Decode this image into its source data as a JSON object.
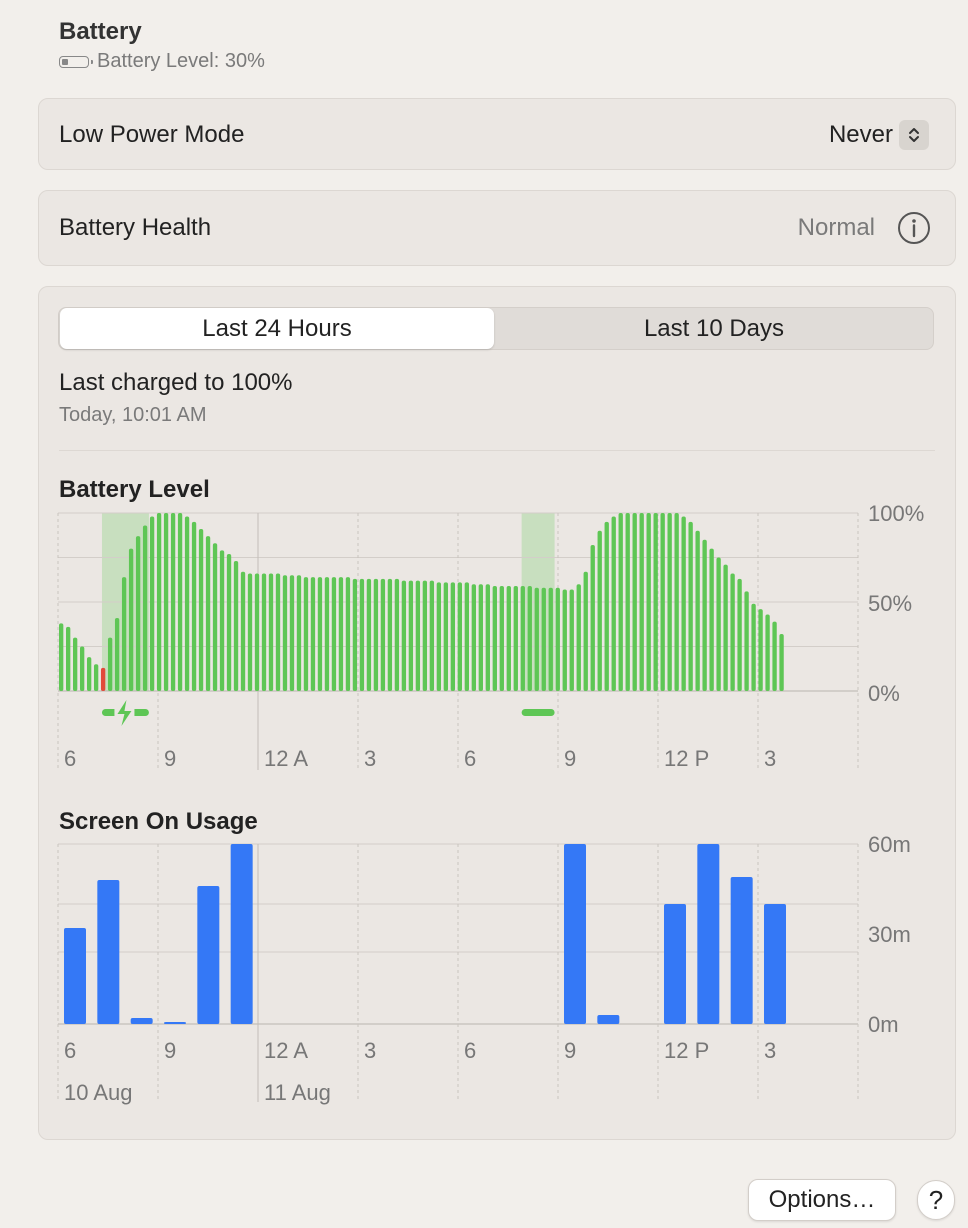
{
  "header": {
    "title": "Battery",
    "battery_level": "Battery Level: 30%"
  },
  "low_power_mode": {
    "label": "Low Power Mode",
    "value": "Never"
  },
  "battery_health": {
    "label": "Battery Health",
    "value": "Normal"
  },
  "tabs": [
    {
      "label": "Last 24 Hours",
      "selected": true
    },
    {
      "label": "Last 10 Days",
      "selected": false
    }
  ],
  "last_charged": {
    "title": "Last charged to 100%",
    "time": "Today, 10:01 AM"
  },
  "buttons": {
    "options": "Options…",
    "help": "?"
  },
  "colors": {
    "battery_bar": "#5ec655",
    "low_battery_bar": "#e24a3a",
    "charging_band": "#5ec655",
    "usage_bar": "#3478f6"
  },
  "chart_data": [
    {
      "type": "bar",
      "title": "Battery Level",
      "x_tick_labels": [
        "6",
        "9",
        "12 A",
        "3",
        "6",
        "9",
        "12 P",
        "3"
      ],
      "y_tick_labels": [
        "100%",
        "50%",
        "0%"
      ],
      "ylim": [
        0,
        100
      ],
      "unit": "%",
      "interval_minutes": 15,
      "values": [
        38,
        36,
        30,
        25,
        19,
        15,
        13,
        30,
        41,
        64,
        80,
        87,
        93,
        98,
        100,
        100,
        100,
        100,
        98,
        95,
        91,
        87,
        83,
        79,
        77,
        73,
        67,
        66,
        66,
        66,
        66,
        66,
        65,
        65,
        65,
        64,
        64,
        64,
        64,
        64,
        64,
        64,
        63,
        63,
        63,
        63,
        63,
        63,
        63,
        62,
        62,
        62,
        62,
        62,
        61,
        61,
        61,
        61,
        61,
        60,
        60,
        60,
        59,
        59,
        59,
        59,
        59,
        59,
        58,
        58,
        58,
        58,
        57,
        57,
        60,
        67,
        82,
        90,
        95,
        98,
        100,
        100,
        100,
        100,
        100,
        100,
        100,
        100,
        100,
        98,
        95,
        90,
        85,
        80,
        75,
        71,
        66,
        63,
        56,
        49,
        46,
        43,
        39,
        32
      ],
      "low_indices": [
        6
      ],
      "charging_periods": [
        {
          "start_index": 6,
          "end_index": 12
        },
        {
          "start_index": 66,
          "end_index": 70
        }
      ]
    },
    {
      "type": "bar",
      "title": "Screen On Usage",
      "x_tick_labels": [
        "6",
        "9",
        "12 A",
        "3",
        "6",
        "9",
        "12 P",
        "3"
      ],
      "date_labels": [
        "10 Aug",
        "11 Aug"
      ],
      "y_tick_labels": [
        "60m",
        "30m",
        "0m"
      ],
      "ylim": [
        0,
        60
      ],
      "unit": "minutes",
      "interval_minutes": 60,
      "values": [
        32,
        48,
        2,
        0.5,
        46,
        60,
        0,
        0,
        0,
        0,
        0,
        0,
        0,
        0,
        0,
        60,
        3,
        0,
        40,
        60,
        49,
        40
      ]
    }
  ]
}
